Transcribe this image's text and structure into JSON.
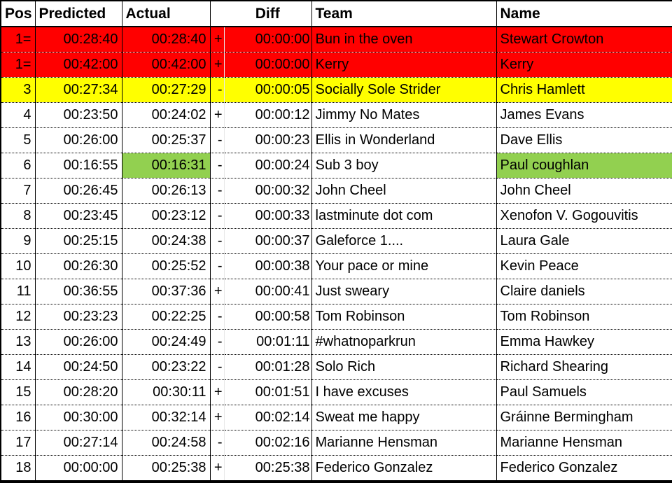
{
  "table": {
    "columns": [
      {
        "key": "pos",
        "label": "Pos",
        "align": "center"
      },
      {
        "key": "pred",
        "label": "Predicted",
        "align": "left"
      },
      {
        "key": "act",
        "label": "Actual",
        "align": "left"
      },
      {
        "key": "diff",
        "label": "Diff",
        "align": "center"
      },
      {
        "key": "team",
        "label": "Team",
        "align": "left"
      },
      {
        "key": "name",
        "label": "Name",
        "align": "left"
      }
    ],
    "colors": {
      "red": "#FF0000",
      "yellow": "#FFFF00",
      "green": "#92D050",
      "white": "#FFFFFF",
      "grid": "#000000"
    },
    "rows": [
      {
        "pos": "1=",
        "pred": "00:28:40",
        "act": "00:28:40",
        "sign": "+",
        "diff": "00:00:00",
        "team": "Bun in the oven",
        "name": "Stewart Crowton",
        "fill": {
          "pos": "red",
          "pred": "red",
          "act": "red",
          "sign": "red",
          "diff": "red",
          "team": "red",
          "name": "red"
        }
      },
      {
        "pos": "1=",
        "pred": "00:42:00",
        "act": "00:42:00",
        "sign": "+",
        "diff": "00:00:00",
        "team": "Kerry",
        "name": "Kerry",
        "fill": {
          "pos": "red",
          "pred": "red",
          "act": "red",
          "sign": "red",
          "diff": "red",
          "team": "red",
          "name": "red"
        }
      },
      {
        "pos": "3",
        "pred": "00:27:34",
        "act": "00:27:29",
        "sign": "-",
        "diff": "00:00:05",
        "team": "Socially Sole Strider",
        "name": "Chris Hamlett",
        "fill": {
          "pos": "yellow",
          "pred": "yellow",
          "act": "yellow",
          "sign": "yellow",
          "diff": "yellow",
          "team": "yellow",
          "name": "yellow"
        }
      },
      {
        "pos": "4",
        "pred": "00:23:50",
        "act": "00:24:02",
        "sign": "+",
        "diff": "00:00:12",
        "team": "Jimmy No Mates",
        "name": "James Evans",
        "fill": {
          "pos": "white",
          "pred": "white",
          "act": "white",
          "sign": "white",
          "diff": "white",
          "team": "white",
          "name": "white"
        }
      },
      {
        "pos": "5",
        "pred": "00:26:00",
        "act": "00:25:37",
        "sign": "-",
        "diff": "00:00:23",
        "team": "Ellis in Wonderland",
        "name": "Dave Ellis",
        "fill": {
          "pos": "white",
          "pred": "white",
          "act": "white",
          "sign": "white",
          "diff": "white",
          "team": "white",
          "name": "white"
        }
      },
      {
        "pos": "6",
        "pred": "00:16:55",
        "act": "00:16:31",
        "sign": "-",
        "diff": "00:00:24",
        "team": "Sub 3 boy",
        "name": "Paul coughlan",
        "fill": {
          "pos": "white",
          "pred": "white",
          "act": "green",
          "sign": "white",
          "diff": "white",
          "team": "white",
          "name": "green"
        }
      },
      {
        "pos": "7",
        "pred": "00:26:45",
        "act": "00:26:13",
        "sign": "-",
        "diff": "00:00:32",
        "team": "John Cheel",
        "name": "John Cheel",
        "fill": {
          "pos": "white",
          "pred": "white",
          "act": "white",
          "sign": "white",
          "diff": "white",
          "team": "white",
          "name": "white"
        }
      },
      {
        "pos": "8",
        "pred": "00:23:45",
        "act": "00:23:12",
        "sign": "-",
        "diff": "00:00:33",
        "team": "lastminute dot com",
        "name": "Xenofon V. Gogouvitis",
        "fill": {
          "pos": "white",
          "pred": "white",
          "act": "white",
          "sign": "white",
          "diff": "white",
          "team": "white",
          "name": "white"
        }
      },
      {
        "pos": "9",
        "pred": "00:25:15",
        "act": "00:24:38",
        "sign": "-",
        "diff": "00:00:37",
        "team": "Galeforce 1....",
        "name": "Laura Gale",
        "fill": {
          "pos": "white",
          "pred": "white",
          "act": "white",
          "sign": "white",
          "diff": "white",
          "team": "white",
          "name": "white"
        }
      },
      {
        "pos": "10",
        "pred": "00:26:30",
        "act": "00:25:52",
        "sign": "-",
        "diff": "00:00:38",
        "team": "Your pace or mine",
        "name": "Kevin Peace",
        "fill": {
          "pos": "white",
          "pred": "white",
          "act": "white",
          "sign": "white",
          "diff": "white",
          "team": "white",
          "name": "white"
        }
      },
      {
        "pos": "11",
        "pred": "00:36:55",
        "act": "00:37:36",
        "sign": "+",
        "diff": "00:00:41",
        "team": "Just sweary",
        "name": "Claire daniels",
        "fill": {
          "pos": "white",
          "pred": "white",
          "act": "white",
          "sign": "white",
          "diff": "white",
          "team": "white",
          "name": "white"
        }
      },
      {
        "pos": "12",
        "pred": "00:23:23",
        "act": "00:22:25",
        "sign": "-",
        "diff": "00:00:58",
        "team": "Tom Robinson",
        "name": "Tom Robinson",
        "fill": {
          "pos": "white",
          "pred": "white",
          "act": "white",
          "sign": "white",
          "diff": "white",
          "team": "white",
          "name": "white"
        }
      },
      {
        "pos": "13",
        "pred": "00:26:00",
        "act": "00:24:49",
        "sign": "-",
        "diff": "00:01:11",
        "team": "#whatnoparkrun",
        "name": "Emma Hawkey",
        "fill": {
          "pos": "white",
          "pred": "white",
          "act": "white",
          "sign": "white",
          "diff": "white",
          "team": "white",
          "name": "white"
        }
      },
      {
        "pos": "14",
        "pred": "00:24:50",
        "act": "00:23:22",
        "sign": "-",
        "diff": "00:01:28",
        "team": "Solo Rich",
        "name": "Richard Shearing",
        "fill": {
          "pos": "white",
          "pred": "white",
          "act": "white",
          "sign": "white",
          "diff": "white",
          "team": "white",
          "name": "white"
        }
      },
      {
        "pos": "15",
        "pred": "00:28:20",
        "act": "00:30:11",
        "sign": "+",
        "diff": "00:01:51",
        "team": "I have excuses",
        "name": "Paul Samuels",
        "fill": {
          "pos": "white",
          "pred": "white",
          "act": "white",
          "sign": "white",
          "diff": "white",
          "team": "white",
          "name": "white"
        }
      },
      {
        "pos": "16",
        "pred": "00:30:00",
        "act": "00:32:14",
        "sign": "+",
        "diff": "00:02:14",
        "team": "Sweat me happy",
        "name": "Gráinne Bermingham",
        "fill": {
          "pos": "white",
          "pred": "white",
          "act": "white",
          "sign": "white",
          "diff": "white",
          "team": "white",
          "name": "white"
        }
      },
      {
        "pos": "17",
        "pred": "00:27:14",
        "act": "00:24:58",
        "sign": "-",
        "diff": "00:02:16",
        "team": "Marianne Hensman",
        "name": "Marianne Hensman",
        "fill": {
          "pos": "white",
          "pred": "white",
          "act": "white",
          "sign": "white",
          "diff": "white",
          "team": "white",
          "name": "white"
        }
      },
      {
        "pos": "18",
        "pred": "00:00:00",
        "act": "00:25:38",
        "sign": "+",
        "diff": "00:25:38",
        "team": "Federico Gonzalez",
        "name": "Federico Gonzalez",
        "fill": {
          "pos": "white",
          "pred": "white",
          "act": "white",
          "sign": "white",
          "diff": "white",
          "team": "white",
          "name": "white"
        }
      }
    ]
  }
}
